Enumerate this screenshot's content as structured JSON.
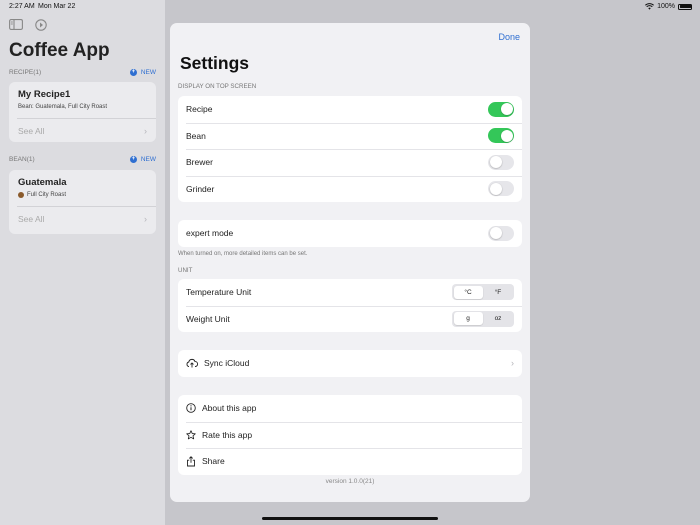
{
  "status": {
    "time": "2:27 AM",
    "date": "Mon Mar 22",
    "battery": "100%"
  },
  "sidebar": {
    "title": "Coffee App",
    "recipe_section": {
      "label": "RECIPE(1)",
      "new_label": "NEW"
    },
    "recipe_card": {
      "title": "My Recipe1",
      "subtitle": "Bean:  Guatemala, Full City Roast",
      "see_all": "See All"
    },
    "bean_section": {
      "label": "BEAN(1)",
      "new_label": "NEW"
    },
    "bean_card": {
      "title": "Guatemala",
      "subtitle": "Full City Roast",
      "dot_color": "#8a5a2b",
      "see_all": "See All"
    }
  },
  "settings": {
    "done_label": "Done",
    "title": "Settings",
    "display_section_label": "DISPLAY ON TOP SCREEN",
    "display_items": [
      {
        "label": "Recipe",
        "on": true
      },
      {
        "label": "Bean",
        "on": true
      },
      {
        "label": "Brewer",
        "on": false
      },
      {
        "label": "Grinder",
        "on": false
      }
    ],
    "expert_mode": {
      "label": "expert mode",
      "on": false,
      "note": "When turned on, more detailed items can be set."
    },
    "unit_section_label": "UNIT",
    "temperature": {
      "label": "Temperature Unit",
      "options": [
        "°C",
        "°F"
      ],
      "selected": "°C"
    },
    "weight": {
      "label": "Weight Unit",
      "options": [
        "g",
        "oz"
      ],
      "selected": "g"
    },
    "sync": {
      "label": "Sync iCloud",
      "icon": "cloud-upload-icon"
    },
    "about": {
      "label": "About this app",
      "icon": "info-icon"
    },
    "rate": {
      "label": "Rate this app",
      "icon": "star-icon"
    },
    "share": {
      "label": "Share",
      "icon": "share-icon"
    },
    "version": "version 1.0.0(21)"
  },
  "colors": {
    "accent": "#2f6fd1",
    "toggle_on": "#34c759"
  }
}
